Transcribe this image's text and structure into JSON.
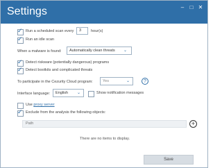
{
  "window": {
    "title": "Settings"
  },
  "schedule": {
    "label": "Run a scheduled scan every",
    "value": "3",
    "unit": "hour(s)",
    "checked": true
  },
  "idle": {
    "label": "Run an idle scan",
    "checked": true
  },
  "malware": {
    "label": "When a malware is found:",
    "selected": "Automatically clean threats"
  },
  "pup": {
    "label": "Detect riskware (potentially dangerous) programs",
    "checked": true
  },
  "rootkits": {
    "label": "Detect bootkits and complicated threats",
    "checked": true
  },
  "cloud": {
    "label": "To participate in the Cezurity Cloud program:",
    "selected": "Yes",
    "help": "?"
  },
  "language": {
    "label": "Interface language:",
    "selected": "English"
  },
  "notifications": {
    "label": "Show notification messages",
    "checked": false
  },
  "proxy": {
    "prefix": "Use",
    "link": "proxy server",
    "checked": false
  },
  "exclude": {
    "label": "Exclude from the analysis the following objects:",
    "checked": true
  },
  "filter": {
    "placeholder": "Path"
  },
  "empty_text": "There are no items to display.",
  "save_label": "Save",
  "colors": {
    "accent": "#2f6fa8",
    "save_bg": "#d7dde3"
  }
}
